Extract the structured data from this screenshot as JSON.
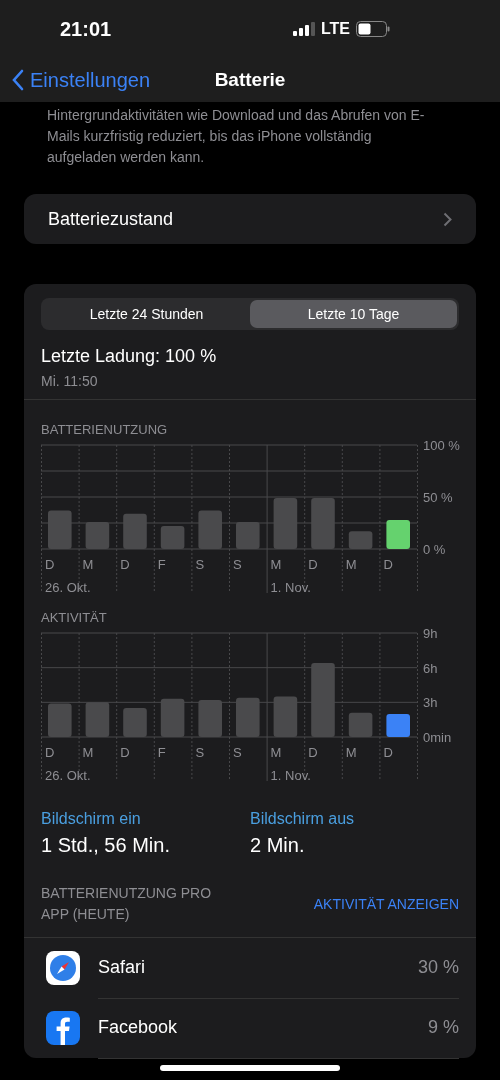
{
  "status_bar": {
    "time": "21:01",
    "network": "LTE"
  },
  "nav": {
    "back_label": "Einstellungen",
    "title": "Batterie"
  },
  "description": "Hintergrundaktivitäten wie Download und das Abrufen von E-Mails kurzfristig reduziert, bis das iPhone vollständig aufgeladen werden kann.",
  "battery_health": {
    "label": "Batteriezustand"
  },
  "tabs": [
    {
      "label": "Letzte 24 Stunden",
      "selected": false
    },
    {
      "label": "Letzte 10 Tage",
      "selected": true
    }
  ],
  "last_charge": {
    "title": "Letzte Ladung: 100 %",
    "time": "Mi. 11:50"
  },
  "charts": [
    {
      "title": "BATTERIENUTZUNG",
      "week_starts": [
        "26. Okt.",
        "1. Nov."
      ],
      "chart_data": {
        "type": "bar",
        "categories": [
          "D",
          "M",
          "D",
          "F",
          "S",
          "S",
          "M",
          "D",
          "M",
          "D"
        ],
        "series": [
          {
            "color": "#4a4a4c",
            "values": [
              37,
              26,
              34,
              22,
              37,
              26,
              49,
              49,
              17,
              null
            ]
          },
          {
            "color": "#65d26e",
            "values": [
              null,
              null,
              null,
              null,
              null,
              null,
              null,
              null,
              null,
              28
            ]
          }
        ],
        "ylim": [
          0,
          100
        ],
        "yticks": [
          {
            "value": 0,
            "label": "0 %"
          },
          {
            "value": 50,
            "label": "50 %"
          },
          {
            "value": 100,
            "label": "100 %"
          }
        ]
      }
    },
    {
      "title": "AKTIVITÄT",
      "week_starts": [
        "26. Okt.",
        "1. Nov."
      ],
      "chart_data": {
        "type": "bar",
        "categories": [
          "D",
          "M",
          "D",
          "F",
          "S",
          "S",
          "M",
          "D",
          "M",
          "D"
        ],
        "series": [
          {
            "color": "#4a4a4c",
            "values": [
              2.9,
              3.0,
              2.5,
              3.3,
              3.2,
              3.4,
              3.5,
              6.4,
              2.1,
              null
            ]
          },
          {
            "color": "#3b82f6",
            "values": [
              null,
              null,
              null,
              null,
              null,
              null,
              null,
              null,
              null,
              2.0
            ]
          }
        ],
        "ylim": [
          0,
          9
        ],
        "yticks": [
          {
            "value": 0,
            "label": "0min"
          },
          {
            "value": 3,
            "label": "3h"
          },
          {
            "value": 6,
            "label": "6h"
          },
          {
            "value": 9,
            "label": "9h"
          }
        ]
      }
    }
  ],
  "screen_time": [
    {
      "label": "Bildschirm ein",
      "value": "1 Std., 56 Min."
    },
    {
      "label": "Bildschirm aus",
      "value": "2 Min."
    }
  ],
  "app_usage": {
    "title": "BATTERIENUTZUNG PRO APP (HEUTE)",
    "action": "AKTIVITÄT ANZEIGEN",
    "apps": [
      {
        "name": "Safari",
        "kind": "safari",
        "percent": "30 %"
      },
      {
        "name": "Facebook",
        "kind": "facebook",
        "percent": "9 %"
      }
    ]
  }
}
